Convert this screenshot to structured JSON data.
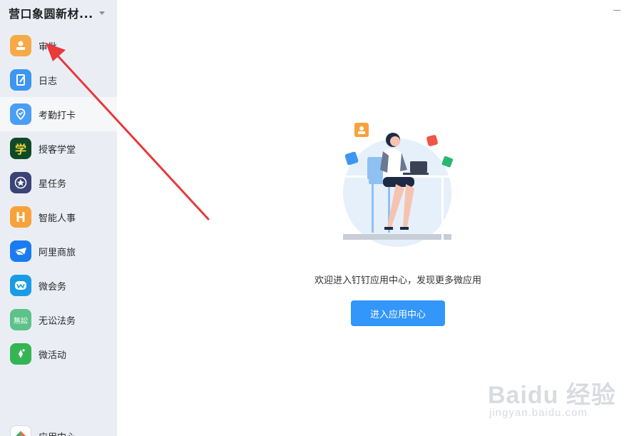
{
  "org": {
    "name": "营口象圆新材..."
  },
  "nav": {
    "items": [
      {
        "label": "审批",
        "icon": "approval-icon",
        "color": "#f7a947"
      },
      {
        "label": "日志",
        "icon": "log-icon",
        "color": "#3d96f1"
      },
      {
        "label": "考勤打卡",
        "icon": "checkin-location-icon",
        "color": "#4a9ef6"
      },
      {
        "label": "授客学堂",
        "icon": "learning-icon",
        "color": "#0f4a26"
      },
      {
        "label": "星任务",
        "icon": "star-task-icon",
        "color": "#3a4476"
      },
      {
        "label": "智能人事",
        "icon": "hr-icon",
        "color": "#f7a23a"
      },
      {
        "label": "阿里商旅",
        "icon": "travel-icon",
        "color": "#1a7cf0"
      },
      {
        "label": "微会务",
        "icon": "meeting-icon",
        "color": "#1a9be6"
      },
      {
        "label": "无讼法务",
        "icon": "legal-icon",
        "color": "#5cc28a"
      },
      {
        "label": "微活动",
        "icon": "activity-icon",
        "color": "#35b454"
      }
    ],
    "icon_glyphs": [
      "学",
      "無訟"
    ],
    "bottom": {
      "label": "应用中心",
      "icon": "app-center-icon"
    }
  },
  "main": {
    "welcome_text": "欢迎进入钉钉应用中心，发现更多微应用",
    "enter_button": "进入应用中心"
  },
  "watermark": {
    "main": "Baidu 经验",
    "sub": "jingyan.baidu.com"
  },
  "colors": {
    "accent": "#3296fa",
    "sidebar_bg": "#eaeef4",
    "arrow": "#e8393b"
  }
}
